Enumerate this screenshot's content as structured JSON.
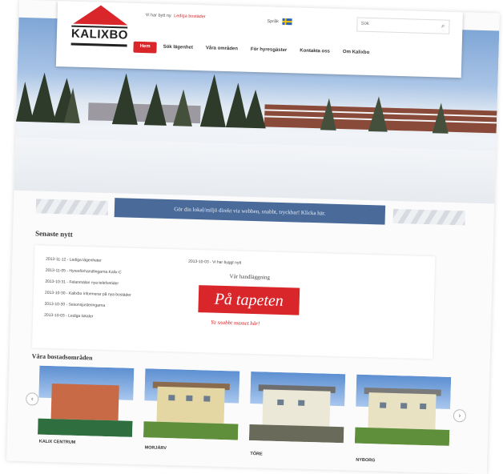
{
  "header": {
    "logo_text": "KALIXBO",
    "util_text": "Vi har bytt ny",
    "util_link": "Lediga bostäder",
    "lang_label": "Språk",
    "search_placeholder": "Sök",
    "nav": [
      "Hem",
      "Sök lägenhet",
      "Våra områden",
      "För hyresgäster",
      "Kontakta oss",
      "Om Kalixbo"
    ]
  },
  "banner": {
    "text": "Gör din lokal/miljö direkt via webben, snabbt, tryckbar! Klicka här."
  },
  "news": {
    "title": "Senaste nytt",
    "items": [
      "2013-11-12 - Lediga lägenheter",
      "2013-11-05 - Hyresförhandlingarna Kalix-C",
      "2013-10-31 - Felanmälan nya telefontider",
      "2013-10-30 - Kalixbo informerar på nya bostäder",
      "2013-10-30 - Sesonsjusteringarna",
      "2013-10-03 - Lediga lokaler"
    ],
    "right_item": "2013-10-03 - Vi har byggt nytt",
    "handling": "Vår handläggning",
    "promo": "På tapeten",
    "promo_sub": "Ya snabbt mamet här!"
  },
  "areas": {
    "title": "Våra bostadsområden",
    "items": [
      "KALIX CENTRUM",
      "MORJÄRV",
      "TÖRE",
      "NYBORG"
    ],
    "prev": "‹",
    "next": "›"
  },
  "colors": {
    "brand_red": "#d8262b",
    "ribbon_blue": "#4a6b9a"
  }
}
